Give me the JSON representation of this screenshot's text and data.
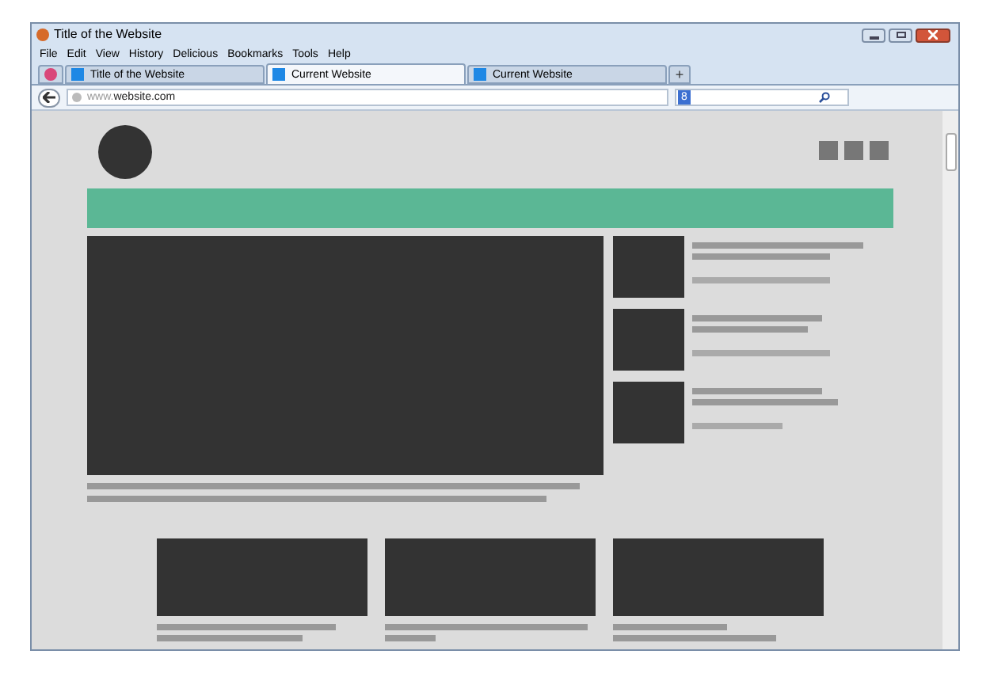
{
  "window": {
    "title": "Title of the Website"
  },
  "menu": [
    "File",
    "Edit",
    "View",
    "History",
    "Delicious",
    "Bookmarks",
    "Tools",
    "Help"
  ],
  "tabs": [
    {
      "label": "Title of the Website",
      "selected": false
    },
    {
      "label": "Current Website",
      "selected": true
    },
    {
      "label": "Current Website",
      "selected": false
    }
  ],
  "new_tab": "+",
  "address_bar": {
    "prefix": "www.",
    "domain": "website.com"
  },
  "search": {
    "engine_badge": "8"
  }
}
